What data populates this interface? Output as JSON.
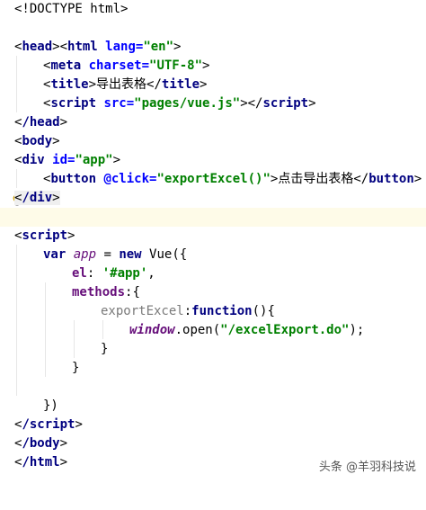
{
  "code": {
    "l1_doctype": "<!DOCTYPE html>",
    "l2_open": "<",
    "l2_tag": "html",
    "l2_attr": " lang=",
    "l2_val": "\"en\"",
    "l2_close": ">",
    "l3": "head",
    "l4_tag": "meta",
    "l4_attr": " charset=",
    "l4_val": "\"UTF-8\"",
    "l5_tag": "title",
    "l5_text": "导出表格",
    "l6_tag": "script",
    "l6_attr": " src=",
    "l6_val": "\"pages/vue.js\"",
    "l7": "/head",
    "l8": "body",
    "l9_tag": "div",
    "l9_attr": " id=",
    "l9_val": "\"app\"",
    "l10_tag": "button",
    "l10_attr": " @click=",
    "l10_val": "\"exportExcel()\"",
    "l10_text": "点击导出表格",
    "l11": "/div",
    "l13": "script",
    "l14_var": "var",
    "l14_name": "app",
    "l14_eq": " = ",
    "l14_new": "new",
    "l14_rest": " Vue({",
    "l15_key": "el",
    "l15_colon": ": ",
    "l15_val": "'#app'",
    "l15_comma": ",",
    "l16_key": "methods",
    "l16_rest": ":{",
    "l17_key": "exportExcel",
    "l17_colon": ":",
    "l17_fn": "function",
    "l17_rest": "(){",
    "l18_win": "window",
    "l18_dot": ".",
    "l18_open": "open",
    "l18_paren": "(",
    "l18_val": "\"/excelExport.do\"",
    "l18_end": ");",
    "l19": "}",
    "l20": "}",
    "l22": "})",
    "l23": "/script",
    "l24": "/body",
    "l25": "/html"
  },
  "watermark": "头条 @羊羽科技说",
  "icons": {
    "gutter": "lightbulb-icon"
  }
}
